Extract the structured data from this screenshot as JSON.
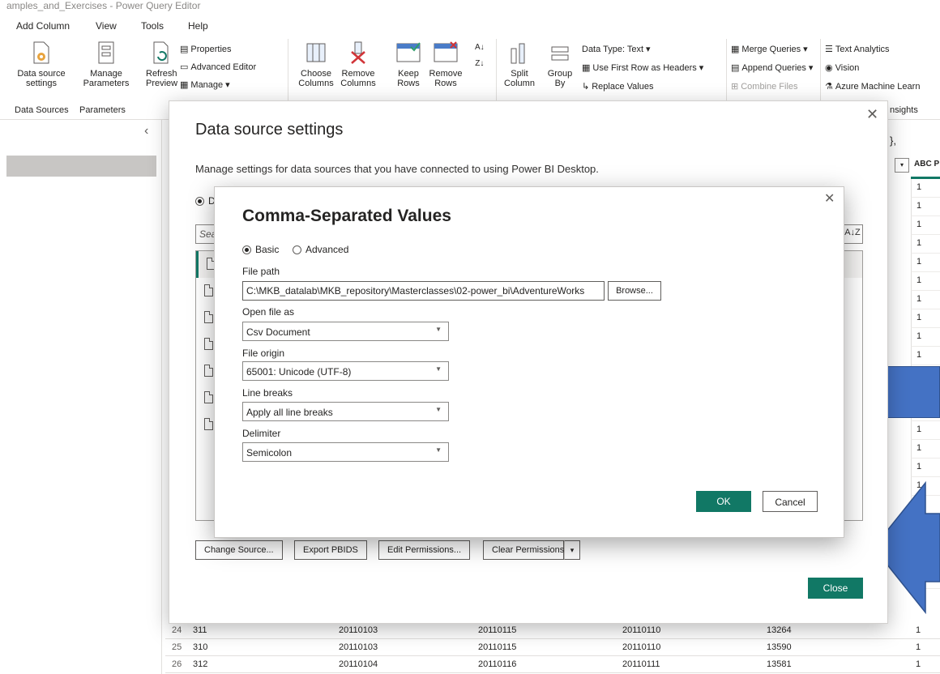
{
  "window": {
    "title": "amples_and_Exercises - Power Query Editor"
  },
  "menu": [
    "Add Column",
    "View",
    "Tools",
    "Help"
  ],
  "ribbon": {
    "data_source_settings": "Data source settings",
    "manage_parameters": "Manage Parameters",
    "refresh_preview": "Refresh Preview",
    "properties": "Properties",
    "advanced_editor": "Advanced Editor",
    "manage": "Manage",
    "choose_columns": "Choose Columns",
    "remove_columns": "Remove Columns",
    "keep_rows": "Keep Rows",
    "remove_rows": "Remove Rows",
    "split_column": "Split Column",
    "group_by": "Group By",
    "data_type": "Data Type: Text",
    "use_first_row": "Use First Row as Headers",
    "replace_values": "Replace Values",
    "merge_queries": "Merge Queries",
    "append_queries": "Append Queries",
    "combine_files": "Combine Files",
    "text_analytics": "Text Analytics",
    "vision": "Vision",
    "azure_ml": "Azure Machine Learn",
    "groups": {
      "data_sources": "Data Sources",
      "parameters": "Parameters",
      "insights": "nsights"
    }
  },
  "background": {
    "formula_tail": "},",
    "right_header": "ABC P",
    "right_col_values": [
      "1",
      "1",
      "1",
      "1",
      "1",
      "1",
      "1",
      "1",
      "1",
      "1",
      "1",
      "1",
      "1",
      "1",
      "1",
      "1",
      "1",
      "1",
      "1",
      "1",
      "1",
      "1"
    ],
    "rows": [
      {
        "n": "24",
        "c1": "311",
        "c2": "20110103",
        "c3": "20110115",
        "c4": "20110110",
        "c5": "13264",
        "c6": "1"
      },
      {
        "n": "25",
        "c1": "310",
        "c2": "20110103",
        "c3": "20110115",
        "c4": "20110110",
        "c5": "13590",
        "c6": "1"
      },
      {
        "n": "26",
        "c1": "312",
        "c2": "20110104",
        "c3": "20110116",
        "c4": "20110111",
        "c5": "13581",
        "c6": "1"
      }
    ]
  },
  "ds_dialog": {
    "title": "Data source settings",
    "description": "Manage settings for data sources that you have connected to using Power BI Desktop.",
    "radio_label": "D",
    "search_placeholder": "Sea",
    "sort_label": "A↓Z",
    "buttons": {
      "change_source": "Change Source...",
      "export_pbids": "Export PBIDS",
      "edit_permissions": "Edit Permissions...",
      "clear_permissions": "Clear Permissions",
      "close": "Close"
    }
  },
  "csv_dialog": {
    "title": "Comma-Separated Values",
    "mode_basic": "Basic",
    "mode_advanced": "Advanced",
    "file_path_label": "File path",
    "file_path_value": "C:\\MKB_datalab\\MKB_repository\\Masterclasses\\02-power_bi\\AdventureWorks",
    "browse": "Browse...",
    "open_as_label": "Open file as",
    "open_as_value": "Csv Document",
    "origin_label": "File origin",
    "origin_value": "65001: Unicode (UTF-8)",
    "line_breaks_label": "Line breaks",
    "line_breaks_value": "Apply all line breaks",
    "delimiter_label": "Delimiter",
    "delimiter_value": "Semicolon",
    "ok": "OK",
    "cancel": "Cancel"
  },
  "colors": {
    "accent": "#117865",
    "annotation_blue": "#4472c4"
  }
}
